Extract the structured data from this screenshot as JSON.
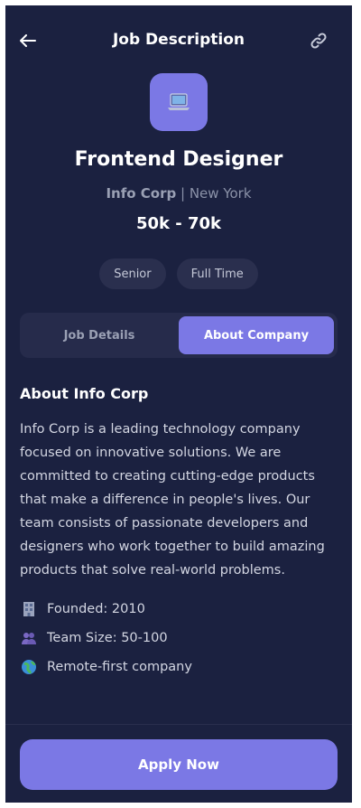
{
  "header": {
    "title": "Job Description",
    "back_icon": "arrow-left-icon",
    "share_icon": "link-icon"
  },
  "job": {
    "logo_icon": "laptop-icon",
    "title": "Frontend Designer",
    "company": "Info Corp",
    "separator": " | ",
    "location": "New York",
    "salary": "50k - 70k",
    "tags": [
      "Senior",
      "Full Time"
    ]
  },
  "tabs": {
    "details_label": "Job Details",
    "company_label": "About Company",
    "active": "About Company"
  },
  "about": {
    "title": "About Info Corp",
    "description": "Info Corp is a leading technology company focused on innovative solutions. We are committed to creating cutting-edge products that make a difference in people's lives. Our team consists of passionate developers and designers who work together to build amazing products that solve real-world problems.",
    "facts": [
      {
        "icon": "building-icon",
        "text": "Founded: 2010"
      },
      {
        "icon": "people-icon",
        "text": "Team Size: 50-100"
      },
      {
        "icon": "globe-icon",
        "text": "Remote-first company"
      }
    ]
  },
  "footer": {
    "apply_label": "Apply Now"
  },
  "colors": {
    "background": "#1b2140",
    "accent": "#7b78e5",
    "surface": "#262b4b",
    "tag_bg": "#2a2f4e"
  }
}
